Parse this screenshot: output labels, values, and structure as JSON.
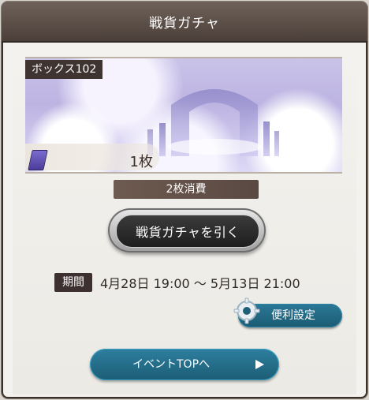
{
  "window": {
    "title": "戦貨ガチャ"
  },
  "banner": {
    "box_label": "ボックス102",
    "item_count": "1枚"
  },
  "gacha": {
    "cost_text": "2枚消費",
    "draw_button_label": "戦貨ガチャを引く"
  },
  "period": {
    "label": "期間",
    "text": "4月28日 19:00 ～ 5月13日 21:00"
  },
  "settings": {
    "button_label": "便利設定"
  },
  "event": {
    "button_label": "イベントTOPへ"
  },
  "colors": {
    "title_bg": "#5b4f49",
    "accent_blue": "#1f5f78",
    "cost_bar": "#6d5a50"
  },
  "icons": {
    "ticket": "ticket-icon",
    "gear": "gear-icon",
    "arrow": "play-arrow-icon"
  }
}
